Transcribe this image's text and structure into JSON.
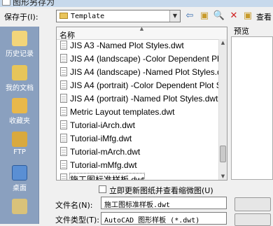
{
  "window": {
    "title": "图形另存为"
  },
  "save_in": {
    "label": "保存于(I):",
    "value": "Template"
  },
  "toolbar": {
    "view_label": "查看"
  },
  "places": [
    {
      "label": "历史记录",
      "icon": "history-icon",
      "color": "#f3d57a"
    },
    {
      "label": "我的文档",
      "icon": "documents-icon",
      "color": "#e7c55a"
    },
    {
      "label": "收藏夹",
      "icon": "favorites-icon",
      "color": "#e9b84a"
    },
    {
      "label": "FTP",
      "icon": "ftp-icon",
      "color": "#d9a93e"
    },
    {
      "label": "桌面",
      "icon": "desktop-icon",
      "color": "#5a8fd4"
    },
    {
      "label": "",
      "icon": "buzzsaw-icon",
      "color": "#d9c27a"
    }
  ],
  "file_list": {
    "column_header": "名称",
    "files": [
      "JIS A3 -Named Plot Styles.dwt",
      "JIS A4 (landscape) -Color Dependent Plot Sty",
      "JIS A4 (landscape) -Named Plot Styles.dwt",
      "JIS A4 (portrait) -Color Dependent Plot Style",
      "JIS A4 (portrait) -Named Plot Styles.dwt",
      "Metric Layout templates.dwt",
      "Tutorial-iArch.dwt",
      "Tutorial-iMfg.dwt",
      "Tutorial-mArch.dwt",
      "Tutorial-mMfg.dwt",
      "施工图标准样板.dwt"
    ]
  },
  "preview": {
    "label": "预览"
  },
  "options": {
    "update_thumbnail_label": "立即更新图纸并查看缩微图(U)"
  },
  "file_name": {
    "label": "文件名(N):",
    "value": "施工图标准样板.dwt"
  },
  "file_type": {
    "label": "文件类型(T):",
    "value": "AutoCAD 图形样板 (*.dwt)"
  }
}
